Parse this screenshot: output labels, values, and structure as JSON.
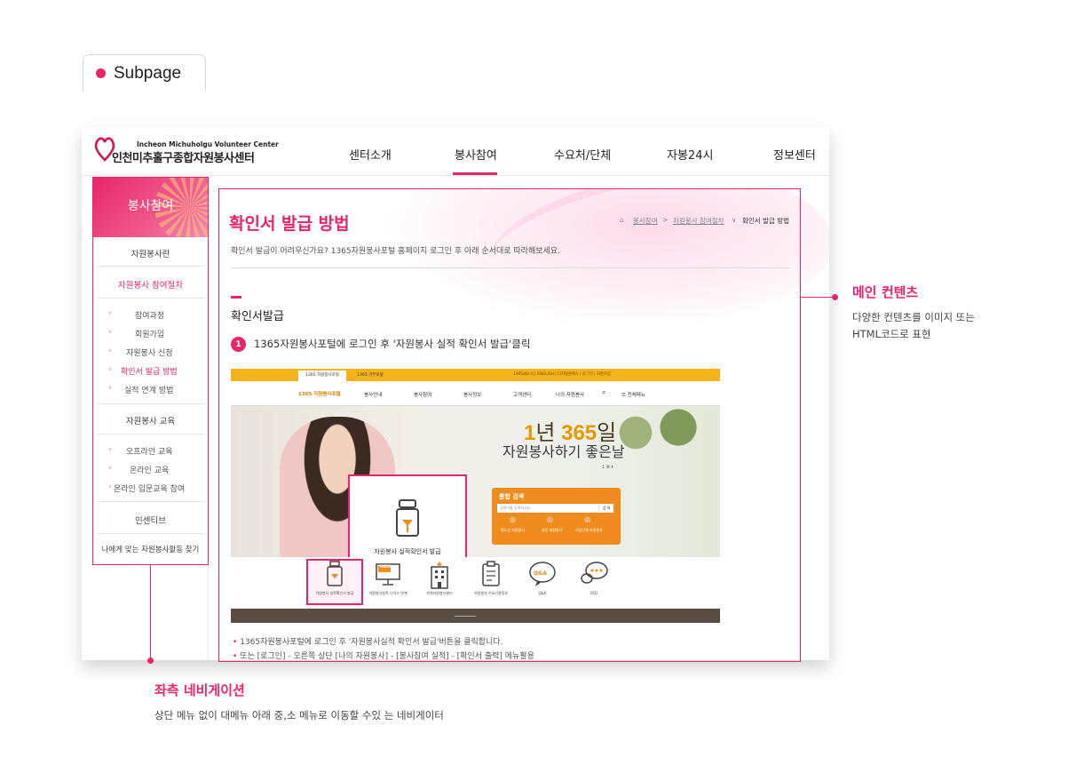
{
  "tab_label": "Subpage",
  "header": {
    "logo_en": "Incheon Michuholgu Volunteer Center",
    "logo_ko": "인천미추홀구종합자원봉사센터",
    "gnb": [
      "센터소개",
      "봉사참여",
      "수요처/단체",
      "자봉24시",
      "정보센터"
    ],
    "active_gnb": "봉사참여"
  },
  "lnb": {
    "title": "봉사참여",
    "sec1": "자원봉사란",
    "sec2": "자원봉사 참여절차",
    "sub2": [
      "참여과정",
      "회원가입",
      "자원봉사 신청",
      "확인서 발급 방법",
      "실적 연계 방법"
    ],
    "sec3": "자원봉사 교육",
    "sub3": [
      "오프라인 교육",
      "온라인 교육",
      "온라인 입문교육 참여"
    ],
    "sec4": "인센티브",
    "sec5": "나에게 맞는 자원봉사활동 찾기"
  },
  "content": {
    "title": "확인서 발급 방법",
    "breadcrumb": [
      "봉사참여",
      ">",
      "자원봉사 참여절차",
      "∨",
      "확인서 발급 방법"
    ],
    "intro": "확인서 발급이 어려우신가요? 1365자원봉사포털 홈페이지 로그인 후 아래 순서대로 따라해보세요.",
    "section_title": "확인서발급",
    "step_num": "1",
    "step_text": "1365자원봉사포털에 로그인 후 '자원봉사 실적 확인서 발급'클릭",
    "note1": "1365자원봉사포털에 로그인 후 '자원봉사실적 확인서 발급'버튼을 클릭합니다.",
    "note2": "또는 [로그인] - 오른쪽 상단 [나의 자원봉사] - [봉사참여 실적] - [확인서 출력] 메뉴활용"
  },
  "screenshot": {
    "tab1": "1365 자원봉사포털",
    "tab2": "1365 기부포털",
    "toplinks": "1365새소식 | ENGLISH | 디지털원패스 | 로그인 | 회원가입",
    "logo": "1365 자원봉사포털",
    "menu": [
      "봉사안내",
      "봉사참여",
      "봉사정보",
      "고객센터",
      "나의 자원봉사",
      "☰ 전체메뉴"
    ],
    "hero_1": "1",
    "hero_nyeon": "년 ",
    "hero_365": "365",
    "hero_il": "일",
    "hero_line2": "자원봉사하기 좋은날",
    "pager": "1 ⦾ ⏵",
    "search_title": "통합 검색",
    "search_placeholder": "검색어를 입력하세요.",
    "search_btn": "검 색",
    "search_links": [
      "청소년 자원봉사",
      "성인 자원봉사",
      "기업단체 자원봉사"
    ],
    "popup_label": "자원봉사 실적확인서 발급",
    "icons": [
      "자원봉사 실적확인서 발급",
      "자원봉사실적 나이스 연계",
      "자역자원봉사센터",
      "자원봉사 수요기관정보",
      "Q&A",
      "FAQ"
    ],
    "neis": "NEIS",
    "qa": "Q&A"
  },
  "annotations": {
    "main_title": "메인 컨텐츠",
    "main_desc1": "다양한 컨텐츠를 이미지 또는",
    "main_desc2": "HTML코드로 표현",
    "left_title": "좌측 네비게이션",
    "left_desc": "상단 메뉴 없이 대메뉴 아래 중,소 메뉴로 이동할 수있 는 네비게이터"
  },
  "colors": {
    "accent": "#e8246b",
    "portal_yellow": "#f5b21b",
    "portal_orange": "#f08c1e"
  }
}
